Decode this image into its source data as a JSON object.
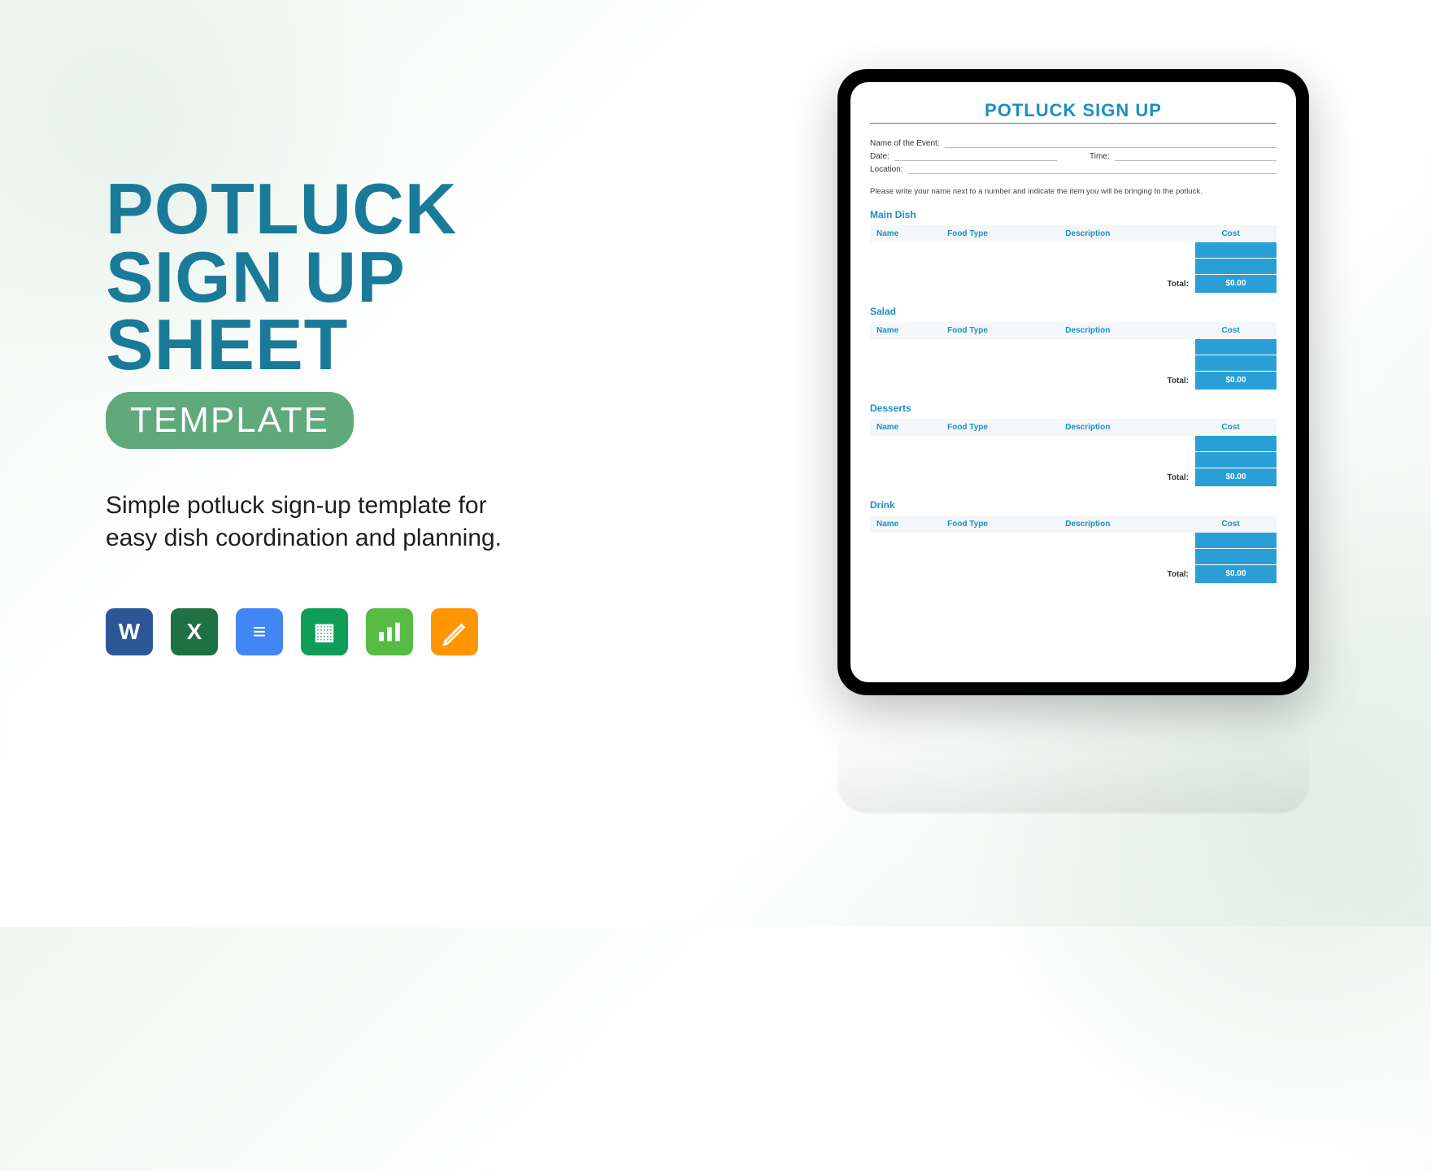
{
  "promo": {
    "title_line1": "POTLUCK",
    "title_line2": "SIGN UP SHEET",
    "badge": "TEMPLATE",
    "description": "Simple potluck sign-up template for easy dish coordination and planning."
  },
  "apps": {
    "word": "W",
    "excel": "X",
    "docs": "≡",
    "sheets": "▦",
    "numbers": "📊",
    "pages": "✎"
  },
  "doc": {
    "title": "POTLUCK SIGN UP",
    "fields": {
      "event_label": "Name of the Event:",
      "date_label": "Date:",
      "time_label": "Time:",
      "location_label": "Location:"
    },
    "instructions": "Please write your name next to a number and indicate the item you will be bringing to the potluck.",
    "columns": {
      "name": "Name",
      "food": "Food Type",
      "desc": "Description",
      "cost": "Cost"
    },
    "total_label": "Total:",
    "sections": [
      {
        "title": "Main Dish",
        "total": "$0.00"
      },
      {
        "title": "Salad",
        "total": "$0.00"
      },
      {
        "title": "Desserts",
        "total": "$0.00"
      },
      {
        "title": "Drink",
        "total": "$0.00"
      }
    ]
  }
}
